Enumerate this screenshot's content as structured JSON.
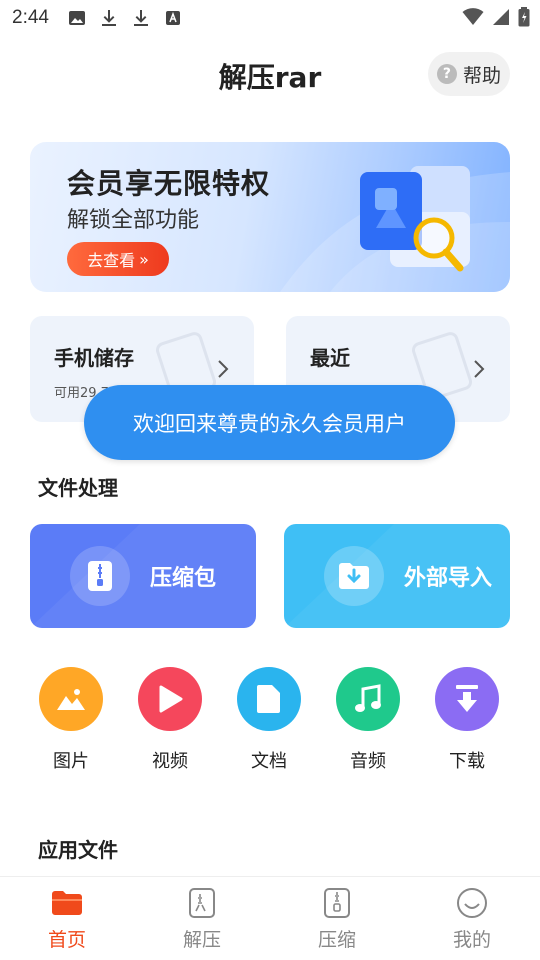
{
  "status_bar": {
    "time": "2:44",
    "notification_icons": [
      "image-icon",
      "download-icon",
      "download-icon",
      "font-icon"
    ],
    "system_icons": [
      "wifi-icon",
      "signal-icon",
      "battery-icon"
    ]
  },
  "header": {
    "title": "解压rar",
    "help_label": "帮助"
  },
  "banner": {
    "title": "会员享无限特权",
    "subtitle": "解锁全部功能",
    "button_label": "去查看",
    "button_glyph": "»"
  },
  "storage_cards": [
    {
      "title": "手机储存",
      "subtitle": "可用29.7"
    },
    {
      "title": "最近",
      "subtitle": ""
    }
  ],
  "toast": {
    "text": "欢迎回来尊贵的永久会员用户"
  },
  "sections": {
    "file_processing": "文件处理",
    "app_files": "应用文件"
  },
  "actions": [
    {
      "label": "压缩包",
      "color": "#5b7cf7"
    },
    {
      "label": "外部导入",
      "color": "#3fbff5"
    }
  ],
  "categories": [
    {
      "label": "图片",
      "icon": "image-icon",
      "color": "#ffa726"
    },
    {
      "label": "视频",
      "icon": "play-icon",
      "color": "#f5475c"
    },
    {
      "label": "文档",
      "icon": "document-icon",
      "color": "#2ab4ee"
    },
    {
      "label": "音频",
      "icon": "music-icon",
      "color": "#1fc98c"
    },
    {
      "label": "下载",
      "icon": "download-icon",
      "color": "#8b6cf3"
    }
  ],
  "bottom_nav": [
    {
      "label": "首页",
      "icon": "folder-icon",
      "active": true
    },
    {
      "label": "解压",
      "icon": "unzip-icon",
      "active": false
    },
    {
      "label": "压缩",
      "icon": "zip-icon",
      "active": false
    },
    {
      "label": "我的",
      "icon": "smile-icon",
      "active": false
    }
  ],
  "colors": {
    "accent": "#f04a1b",
    "toast_bg": "#2f8ff0",
    "card_bg": "#eef3fb"
  }
}
